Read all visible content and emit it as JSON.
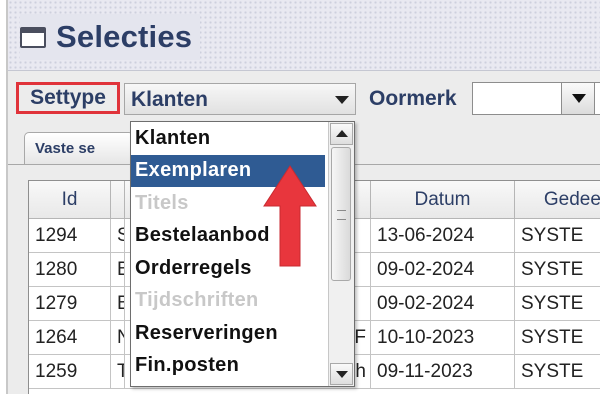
{
  "window": {
    "title": "Selecties",
    "icon": "window-icon"
  },
  "toolbar": {
    "settype_label": "Settype",
    "settype_value": "Klanten",
    "oormerk_label": "Oormerk",
    "oormerk_value": ""
  },
  "tabs": [
    {
      "label": "Vaste se"
    }
  ],
  "table": {
    "columns": [
      "Id",
      "",
      "",
      "Datum",
      "Gedeel"
    ],
    "rows": [
      [
        "1294",
        "S",
        "",
        "13-06-2024",
        "SYSTE"
      ],
      [
        "1280",
        "B",
        "",
        "09-02-2024",
        "SYSTE"
      ],
      [
        "1279",
        "B",
        "",
        "09-02-2024",
        "SYSTE"
      ],
      [
        "1264",
        "N",
        "F",
        "10-10-2023",
        "SYSTE"
      ],
      [
        "1259",
        "T",
        "h",
        "09-11-2023",
        "SYSTE"
      ]
    ]
  },
  "dropdown": {
    "items": [
      {
        "label": "Klanten",
        "state": "normal"
      },
      {
        "label": "Exemplaren",
        "state": "selected"
      },
      {
        "label": "Titels",
        "state": "disabled"
      },
      {
        "label": "Bestelaanbod",
        "state": "normal"
      },
      {
        "label": "Orderregels",
        "state": "normal"
      },
      {
        "label": "Tijdschriften",
        "state": "disabled"
      },
      {
        "label": "Reserveringen",
        "state": "normal"
      },
      {
        "label": "Fin.posten",
        "state": "normal"
      }
    ]
  },
  "colors": {
    "accent": "#2f5b93",
    "label_text": "#2c3e66",
    "highlight_box": "#e0333a",
    "annotation_arrow": "#e8363d"
  }
}
